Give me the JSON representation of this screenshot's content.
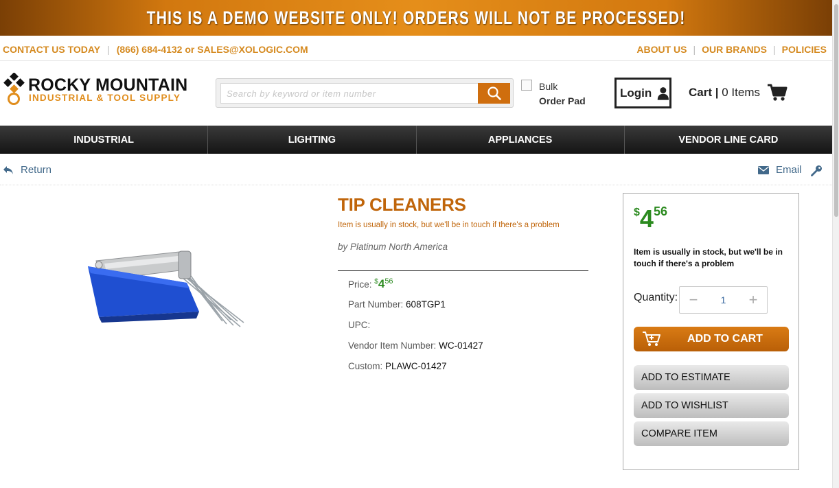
{
  "banner": {
    "text": "THIS IS A DEMO WEBSITE ONLY! ORDERS WILL NOT BE PROCESSED!"
  },
  "contact": {
    "contact_us": "CONTACT US TODAY",
    "phone_email": "(866) 684-4132 or SALES@XOLOGIC.COM",
    "links": [
      "ABOUT US",
      "OUR BRANDS",
      "POLICIES"
    ]
  },
  "logo": {
    "title": "ROCKY MOUNTAIN",
    "subtitle": "INDUSTRIAL & TOOL SUPPLY"
  },
  "search": {
    "placeholder": "Search by keyword or item number",
    "value": ""
  },
  "bulk": {
    "line1": "Bulk",
    "line2": "Order Pad"
  },
  "login": {
    "label": "Login"
  },
  "cart": {
    "label": "Cart |",
    "items": "0 Items"
  },
  "nav": {
    "items": [
      "INDUSTRIAL",
      "LIGHTING",
      "APPLIANCES",
      "VENDOR LINE CARD"
    ]
  },
  "util": {
    "return_label": "Return",
    "email_label": "Email"
  },
  "product": {
    "title": "TIP CLEANERS",
    "stock_message": "Item is usually in stock, but we'll be in touch if there's a problem",
    "brand": "by Platinum North America",
    "price_label": "Price:",
    "price": {
      "dollar_sign": "$",
      "dollars": "4",
      "cents": "56"
    },
    "part_number_label": "Part Number:",
    "part_number": "608TGP1",
    "upc_label": "UPC:",
    "upc": "",
    "vendor_item_label": "Vendor Item Number:",
    "vendor_item": "WC-01427",
    "custom_label": "Custom:",
    "custom": "PLAWC-01427"
  },
  "buy_box": {
    "stock_message": "Item is usually in stock, but we'll be in touch if there's a problem",
    "quantity_label": "Quantity:",
    "quantity": "1",
    "add_to_cart": "ADD TO CART",
    "add_to_estimate": "ADD TO ESTIMATE",
    "add_to_wishlist": "ADD TO WISHLIST",
    "compare_item": "COMPARE ITEM"
  },
  "colors": {
    "accent": "#cf6e0e",
    "price_green": "#2b8a1f",
    "link_blue": "#42698a",
    "nav_dark": "#1e1e1e"
  }
}
